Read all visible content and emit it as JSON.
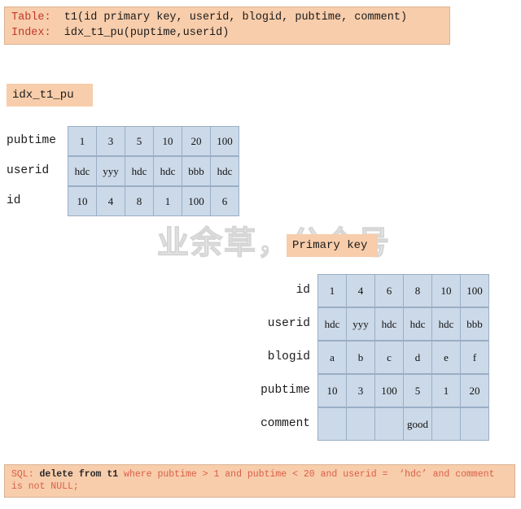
{
  "schema_banner": {
    "rows": [
      {
        "label": "Table:",
        "body": "  t1(id primary key, userid, blogid, pubtime, comment)"
      },
      {
        "label": "Index:",
        "body": "  idx_t1_pu(puptime,userid)"
      }
    ],
    "label_color": "#c0392b",
    "background": "#f8cdab"
  },
  "index_section": {
    "badge": "idx_t1_pu",
    "row_labels": [
      "pubtime",
      "userid",
      "id"
    ],
    "rows": [
      [
        "1",
        "3",
        "5",
        "10",
        "20",
        "100"
      ],
      [
        "hdc",
        "yyy",
        "hdc",
        "hdc",
        "bbb",
        "hdc"
      ],
      [
        "10",
        "4",
        "8",
        "1",
        "100",
        "6"
      ]
    ],
    "cell_fill": "#ccd9e8",
    "cell_border": "#9aaec6"
  },
  "primary_key_section": {
    "badge": "Primary key",
    "row_labels": [
      "id",
      "userid",
      "blogid",
      "pubtime",
      "comment"
    ],
    "rows": [
      [
        "1",
        "4",
        "6",
        "8",
        "10",
        "100"
      ],
      [
        "hdc",
        "yyy",
        "hdc",
        "hdc",
        "hdc",
        "bbb"
      ],
      [
        "a",
        "b",
        "c",
        "d",
        "e",
        "f"
      ],
      [
        "10",
        "3",
        "100",
        "5",
        "1",
        "20"
      ],
      [
        "",
        "",
        "",
        "good",
        "",
        ""
      ]
    ],
    "cell_fill": "#ccd9e8",
    "cell_border": "#9aaec6"
  },
  "watermark": {
    "text": "业余草，公众号"
  },
  "sql_banner": {
    "segments": [
      {
        "text": "SQL: ",
        "style": "red"
      },
      {
        "text": "delete from t1 ",
        "style": "dark"
      },
      {
        "text": "where pubtime > 1 and pubtime < 20 and userid =  ‘hdc’ and comment is not NULL;",
        "style": "red"
      }
    ],
    "text_color": "#d9604a",
    "background": "#f8cdab"
  }
}
